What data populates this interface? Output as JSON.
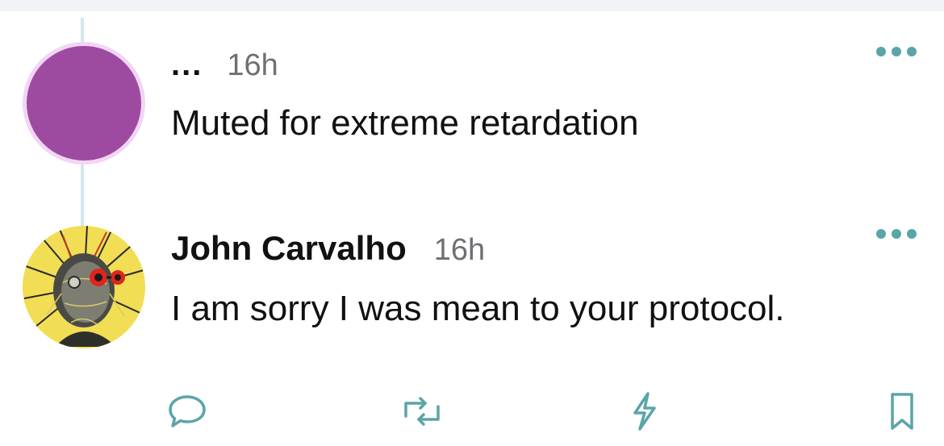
{
  "posts": [
    {
      "author": "...",
      "time": "16h",
      "text": "Muted for extreme retardation",
      "avatar": "purple-circle"
    },
    {
      "author": "John Carvalho",
      "time": "16h",
      "text": "I am sorry I was mean to your protocol.",
      "avatar": "cyberpunk-face-illustration"
    }
  ],
  "actions": {
    "reply_icon": "reply-bubble-icon",
    "repost_icon": "repost-icon",
    "zap_icon": "lightning-icon",
    "bookmark_icon": "bookmark-icon"
  },
  "colors": {
    "accent": "#5aa5a7",
    "muted_avatar": "#9f4aa1",
    "thread_line": "#d3e8ef",
    "timestamp": "#6f6f74"
  }
}
